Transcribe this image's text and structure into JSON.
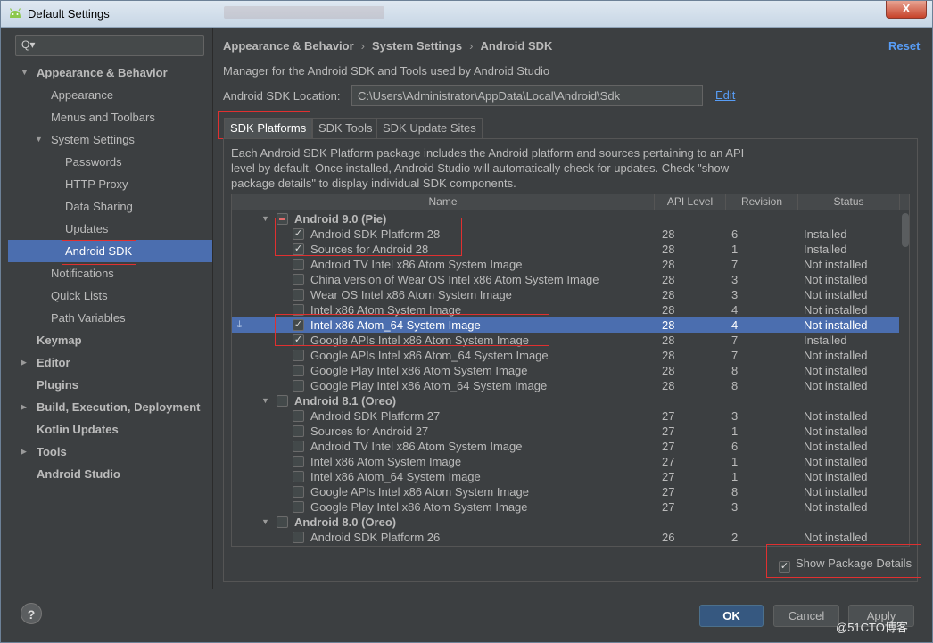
{
  "window": {
    "title": "Default Settings",
    "close_glyph": "X"
  },
  "sidebar": {
    "search_glyph": "Q▾",
    "items": [
      {
        "label": "Appearance & Behavior",
        "level": 0,
        "bold": true,
        "arrow": "▼"
      },
      {
        "label": "Appearance",
        "level": 1
      },
      {
        "label": "Menus and Toolbars",
        "level": 1
      },
      {
        "label": "System Settings",
        "level": 1,
        "arrow": "▼"
      },
      {
        "label": "Passwords",
        "level": 2
      },
      {
        "label": "HTTP Proxy",
        "level": 2
      },
      {
        "label": "Data Sharing",
        "level": 2
      },
      {
        "label": "Updates",
        "level": 2
      },
      {
        "label": "Android SDK",
        "level": 2,
        "selected": true
      },
      {
        "label": "Notifications",
        "level": 1
      },
      {
        "label": "Quick Lists",
        "level": 1
      },
      {
        "label": "Path Variables",
        "level": 1
      },
      {
        "label": "Keymap",
        "level": 0,
        "bold": true
      },
      {
        "label": "Editor",
        "level": 0,
        "bold": true,
        "arrow": "▶"
      },
      {
        "label": "Plugins",
        "level": 0,
        "bold": true
      },
      {
        "label": "Build, Execution, Deployment",
        "level": 0,
        "bold": true,
        "arrow": "▶"
      },
      {
        "label": "Kotlin Updates",
        "level": 0,
        "bold": true
      },
      {
        "label": "Tools",
        "level": 0,
        "bold": true,
        "arrow": "▶"
      },
      {
        "label": "Android Studio",
        "level": 0,
        "bold": true
      }
    ]
  },
  "header": {
    "breadcrumb": [
      "Appearance & Behavior",
      "System Settings",
      "Android SDK"
    ],
    "breadcrumb_sep": "›",
    "reset": "Reset"
  },
  "sdk": {
    "description": "Manager for the Android SDK and Tools used by Android Studio",
    "location_label": "Android SDK Location:",
    "location_value": "C:\\Users\\Administrator\\AppData\\Local\\Android\\Sdk",
    "edit": "Edit"
  },
  "tabs": [
    "SDK Platforms",
    "SDK Tools",
    "SDK Update Sites"
  ],
  "panel_description": "Each Android SDK Platform package includes the Android platform and sources pertaining to an API level by default. Once installed, Android Studio will automatically check for updates. Check \"show package details\" to display individual SDK components.",
  "table": {
    "columns": [
      "Name",
      "API Level",
      "Revision",
      "Status"
    ],
    "rows": [
      {
        "group": true,
        "name": "Android 9.0 (Pie)",
        "state": "partial"
      },
      {
        "name": "Android SDK Platform 28",
        "api": "28",
        "rev": "6",
        "status": "Installed",
        "checked": true
      },
      {
        "name": "Sources for Android 28",
        "api": "28",
        "rev": "1",
        "status": "Installed",
        "checked": true
      },
      {
        "name": "Android TV Intel x86 Atom System Image",
        "api": "28",
        "rev": "7",
        "status": "Not installed"
      },
      {
        "name": "China version of Wear OS Intel x86 Atom System Image",
        "api": "28",
        "rev": "3",
        "status": "Not installed"
      },
      {
        "name": "Wear OS Intel x86 Atom System Image",
        "api": "28",
        "rev": "3",
        "status": "Not installed"
      },
      {
        "name": "Intel x86 Atom System Image",
        "api": "28",
        "rev": "4",
        "status": "Not installed"
      },
      {
        "name": "Intel x86 Atom_64 System Image",
        "api": "28",
        "rev": "4",
        "status": "Not installed",
        "checked": true,
        "selected": true
      },
      {
        "name": "Google APIs Intel x86 Atom System Image",
        "api": "28",
        "rev": "7",
        "status": "Installed",
        "checked": true
      },
      {
        "name": "Google APIs Intel x86 Atom_64 System Image",
        "api": "28",
        "rev": "7",
        "status": "Not installed"
      },
      {
        "name": "Google Play Intel x86 Atom System Image",
        "api": "28",
        "rev": "8",
        "status": "Not installed"
      },
      {
        "name": "Google Play Intel x86 Atom_64 System Image",
        "api": "28",
        "rev": "8",
        "status": "Not installed"
      },
      {
        "group": true,
        "name": "Android 8.1 (Oreo)",
        "state": "none"
      },
      {
        "name": "Android SDK Platform 27",
        "api": "27",
        "rev": "3",
        "status": "Not installed"
      },
      {
        "name": "Sources for Android 27",
        "api": "27",
        "rev": "1",
        "status": "Not installed"
      },
      {
        "name": "Android TV Intel x86 Atom System Image",
        "api": "27",
        "rev": "6",
        "status": "Not installed"
      },
      {
        "name": "Intel x86 Atom System Image",
        "api": "27",
        "rev": "1",
        "status": "Not installed"
      },
      {
        "name": "Intel x86 Atom_64 System Image",
        "api": "27",
        "rev": "1",
        "status": "Not installed"
      },
      {
        "name": "Google APIs Intel x86 Atom System Image",
        "api": "27",
        "rev": "8",
        "status": "Not installed"
      },
      {
        "name": "Google Play Intel x86 Atom System Image",
        "api": "27",
        "rev": "3",
        "status": "Not installed"
      },
      {
        "group": true,
        "name": "Android 8.0 (Oreo)",
        "state": "none"
      },
      {
        "name": "Android SDK Platform 26",
        "api": "26",
        "rev": "2",
        "status": "Not installed"
      }
    ]
  },
  "show_package_details": "Show Package Details",
  "buttons": {
    "ok": "OK",
    "cancel": "Cancel",
    "apply": "Apply",
    "help": "?"
  },
  "watermark": "@51CTO博客",
  "colors": {
    "selection": "#4b6eaf",
    "link": "#589df6",
    "highlight_box": "#e03030",
    "background": "#3c3f41"
  }
}
